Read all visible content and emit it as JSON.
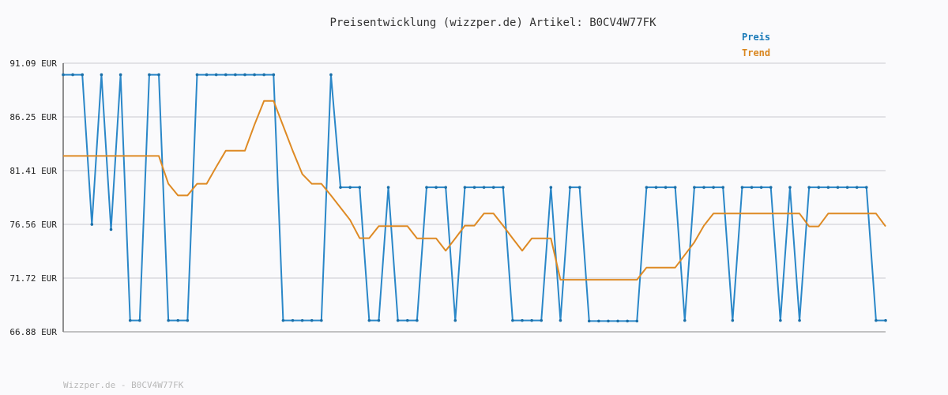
{
  "chart_data": {
    "type": "line",
    "title": "Preisentwicklung (wizzper.de) Artikel: B0CV4W77FK",
    "yticks": [
      "91.09 EUR",
      "86.25 EUR",
      "81.41 EUR",
      "76.56 EUR",
      "71.72 EUR",
      "66.88 EUR"
    ],
    "ylim": [
      66.88,
      91.09
    ],
    "grid": true,
    "legend_position": "top-right",
    "colors": {
      "Preis": "#2a87c8",
      "Trend": "#de8a24"
    },
    "series": [
      {
        "name": "Preis",
        "values": [
          90.05,
          90.05,
          90.05,
          76.56,
          90.05,
          76.1,
          90.05,
          67.9,
          67.9,
          90.05,
          90.05,
          67.9,
          67.9,
          67.9,
          90.05,
          90.05,
          90.05,
          90.05,
          90.05,
          90.05,
          90.05,
          90.05,
          90.05,
          67.9,
          67.9,
          67.9,
          67.9,
          67.9,
          90.05,
          79.9,
          79.9,
          79.9,
          67.9,
          67.9,
          79.9,
          67.9,
          67.9,
          67.9,
          79.9,
          79.9,
          79.9,
          67.9,
          79.9,
          79.9,
          79.9,
          79.9,
          79.9,
          67.9,
          67.9,
          67.9,
          67.9,
          79.9,
          67.9,
          79.9,
          79.9,
          67.85,
          67.85,
          67.85,
          67.85,
          67.85,
          67.85,
          79.9,
          79.9,
          79.9,
          79.9,
          67.9,
          79.9,
          79.9,
          79.9,
          79.9,
          67.9,
          79.9,
          79.9,
          79.9,
          79.9,
          67.9,
          79.9,
          67.9,
          79.9,
          79.9,
          79.9,
          79.9,
          79.9,
          79.9,
          79.9,
          67.9,
          67.9
        ]
      },
      {
        "name": "Trend",
        "values": [
          82.73,
          82.73,
          82.73,
          82.73,
          82.73,
          82.73,
          82.73,
          82.73,
          82.73,
          82.73,
          82.73,
          80.22,
          79.17,
          79.17,
          80.22,
          80.22,
          81.74,
          83.2,
          83.2,
          83.2,
          85.54,
          87.69,
          87.69,
          85.45,
          83.2,
          81.1,
          80.22,
          80.22,
          79.17,
          78.07,
          76.96,
          75.32,
          75.32,
          76.4,
          76.4,
          76.4,
          76.4,
          75.3,
          75.3,
          75.3,
          74.19,
          75.3,
          76.45,
          76.45,
          77.54,
          77.54,
          76.45,
          75.3,
          74.19,
          75.3,
          75.3,
          75.3,
          71.57,
          71.57,
          71.57,
          71.57,
          71.57,
          71.57,
          71.57,
          71.57,
          71.57,
          72.67,
          72.67,
          72.67,
          72.67,
          73.81,
          74.95,
          76.45,
          77.54,
          77.54,
          77.54,
          77.54,
          77.54,
          77.54,
          77.54,
          77.54,
          77.54,
          77.54,
          76.38,
          76.38,
          77.54,
          77.54,
          77.54,
          77.54,
          77.54,
          77.54,
          76.38
        ]
      }
    ]
  },
  "footer": "Wizzper.de - B0CV4W77FK"
}
